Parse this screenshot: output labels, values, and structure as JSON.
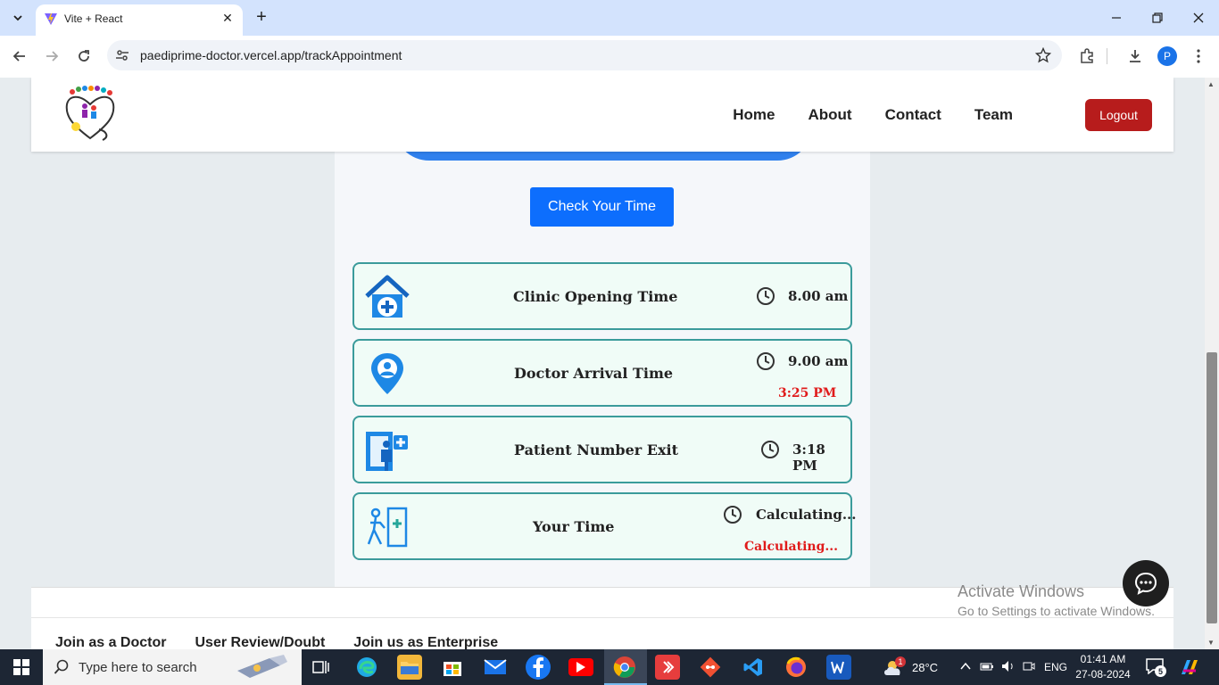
{
  "browser": {
    "tab_title": "Vite + React",
    "url": "paediprime-doctor.vercel.app/trackAppointment",
    "profile_initial": "P"
  },
  "navbar": {
    "links": [
      "Home",
      "About",
      "Contact",
      "Team"
    ],
    "logout_label": "Logout"
  },
  "main": {
    "check_button": "Check Your Time",
    "rows": [
      {
        "label": "Clinic Opening Time",
        "value": "8.00 am"
      },
      {
        "label": "Doctor Arrival Time",
        "value": "9.00 am",
        "secondary": "3:25 PM"
      },
      {
        "label": "Patient Number Exit",
        "value": "3:18 PM"
      },
      {
        "label": "Your Time",
        "value": "Calculating...",
        "secondary": "Calculating..."
      }
    ]
  },
  "footer": {
    "links": [
      "Join as a Doctor",
      "User Review/Doubt",
      "Join us as Enterprise"
    ]
  },
  "watermark": {
    "line1": "Activate Windows",
    "line2": "Go to Settings to activate Windows."
  },
  "taskbar": {
    "search_placeholder": "Type here to search",
    "weather_temp": "28°C",
    "weather_badge": "1",
    "language": "ENG",
    "time": "01:41 AM",
    "date": "27-08-2024",
    "notification_count": "5"
  },
  "colors": {
    "accent_blue": "#0d6efd",
    "logout_red": "#b71c1c",
    "row_border": "#3b9b9b",
    "alert_red": "#e01b1b"
  }
}
